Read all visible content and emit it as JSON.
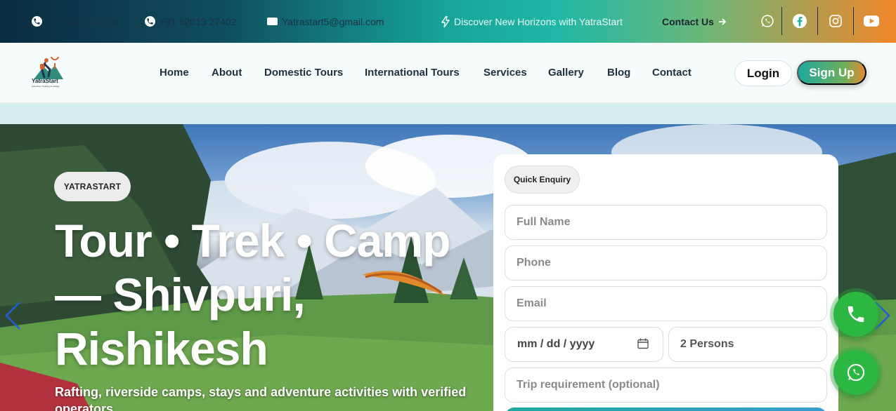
{
  "topbar": {
    "phone1": "91 74151 15138",
    "phone2": "+91 92013 27402",
    "email": "Yatrastart5@gmail.com",
    "tagline": "Discover New Horizons with YatraStart",
    "contact_label": "Contact Us",
    "socials": [
      "whatsapp-icon",
      "facebook-icon",
      "instagram-icon",
      "youtube-icon"
    ]
  },
  "brand": {
    "name": "YatraStart",
    "tagline": "Adventure Trekking & Holiday"
  },
  "nav": {
    "items": [
      "Home",
      "About",
      "Domestic Tours",
      "International Tours",
      "Services",
      "Gallery",
      "Blog",
      "Contact"
    ],
    "login_label": "Login",
    "signup_label": "Sign Up"
  },
  "hero": {
    "badge": "YATRASTART",
    "headline": "Tour • Trek • Camp — Shivpuri, Rishikesh",
    "subline": "Rafting, riverside camps, stays and adventure activities with verified operators"
  },
  "enquiry": {
    "title": "Quick Enquiry",
    "name_placeholder": "Full Name",
    "phone_placeholder": "Phone",
    "email_placeholder": "Email",
    "date_placeholder": "mm / dd / yyyy",
    "persons_value": "2 Persons",
    "requirement_placeholder": "Trip requirement (optional)"
  },
  "colors": {
    "brand_teal": "#1fa89e",
    "brand_orange": "#f0862a",
    "whatsapp_green": "#2cb742"
  }
}
